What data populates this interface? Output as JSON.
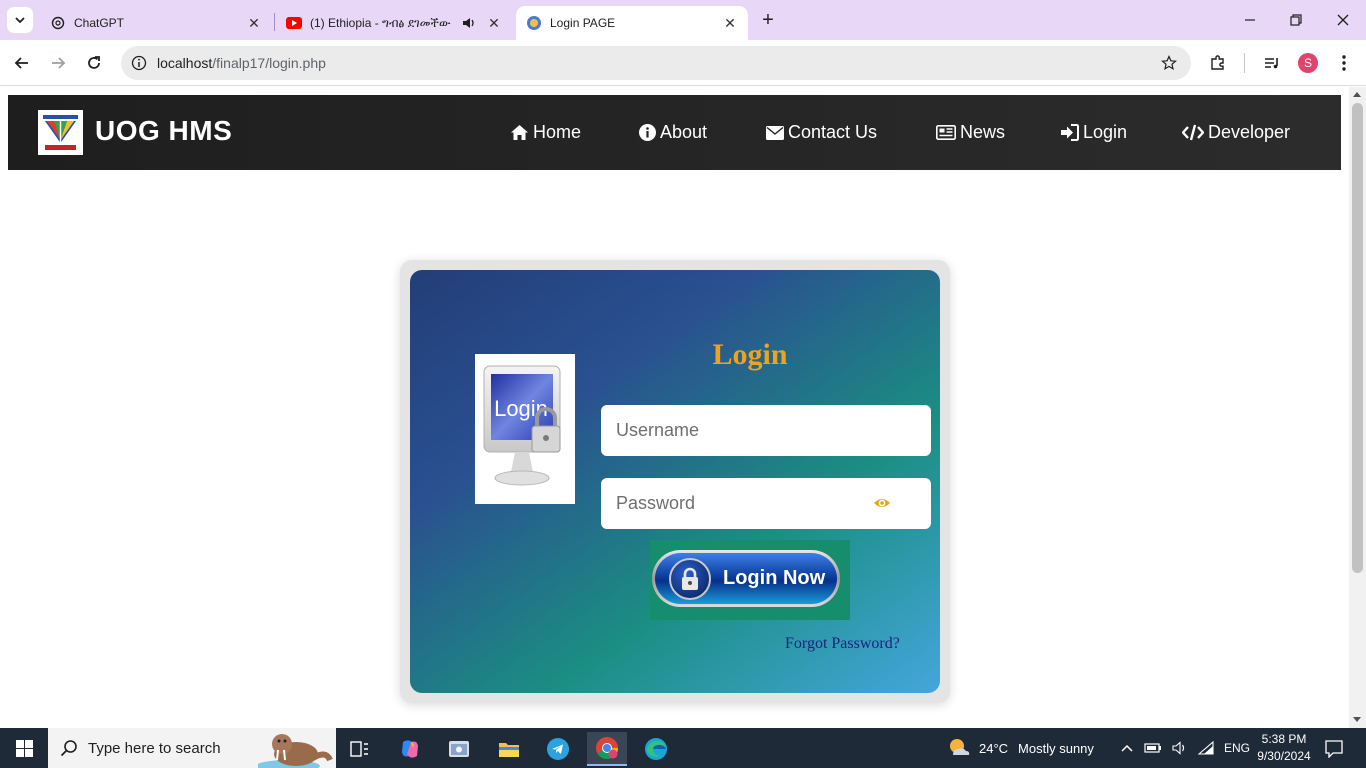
{
  "browser": {
    "tabs": [
      {
        "title": "ChatGPT",
        "active": false
      },
      {
        "title": "(1) Ethiopia - ግብፅ ደገመችው",
        "active": false,
        "audio": true
      },
      {
        "title": "Login PAGE",
        "active": true
      }
    ],
    "url_host": "localhost",
    "url_path": "/finalp17/login.php",
    "profile_initial": "S"
  },
  "navbar": {
    "brand": "UOG HMS",
    "links": [
      {
        "label": "Home",
        "icon": "home-icon"
      },
      {
        "label": "About",
        "icon": "info-icon"
      },
      {
        "label": "Contact Us",
        "icon": "envelope-icon"
      },
      {
        "label": "News",
        "icon": "newspaper-icon"
      },
      {
        "label": "Login",
        "icon": "sign-in-icon"
      },
      {
        "label": "Developer",
        "icon": "code-icon"
      }
    ]
  },
  "login": {
    "title": "Login",
    "image_text": "Login",
    "username_placeholder": "Username",
    "password_placeholder": "Password",
    "button_label": "Login Now",
    "forgot_link": "Forgot Password?"
  },
  "taskbar": {
    "search_placeholder": "Type here to search",
    "weather_temp": "24°C",
    "weather_desc": "Mostly sunny",
    "language": "ENG",
    "time": "5:38 PM",
    "date": "9/30/2024"
  },
  "colors": {
    "navbar_bg": "#1e1e1e",
    "login_title": "#f0a21a",
    "forgot_link": "#1a237e",
    "tab_strip": "#e8d7f7",
    "profile": "#e0446e",
    "taskbar": "#1f2a38"
  }
}
